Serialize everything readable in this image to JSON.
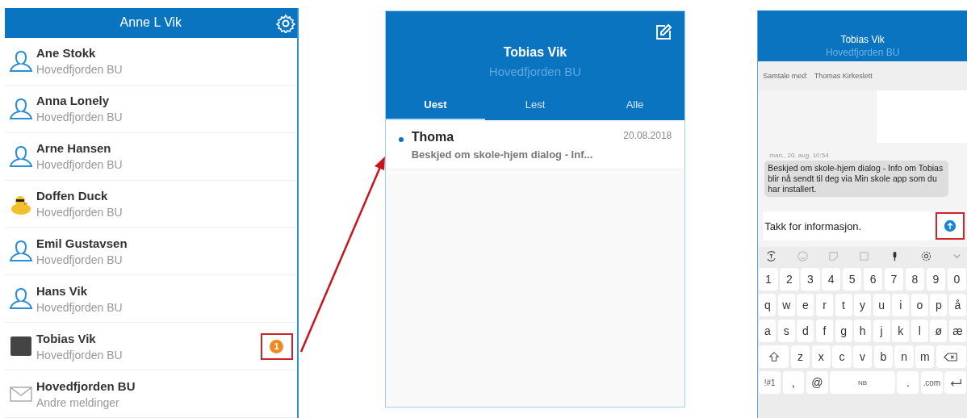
{
  "contacts_panel": {
    "title": "Anne L Vik",
    "contacts": [
      {
        "name": "Ane Stokk",
        "subtitle": "Hovedfjorden BU",
        "kind": "person"
      },
      {
        "name": "Anna Lonely",
        "subtitle": "Hovedfjorden BU",
        "kind": "person"
      },
      {
        "name": "Arne Hansen",
        "subtitle": "Hovedfjorden BU",
        "kind": "person"
      },
      {
        "name": "Doffen Duck",
        "subtitle": "Hovedfjorden BU",
        "kind": "duck"
      },
      {
        "name": "Emil Gustavsen",
        "subtitle": "Hovedfjorden BU",
        "kind": "person"
      },
      {
        "name": "Hans Vik",
        "subtitle": "Hovedfjorden BU",
        "kind": "person"
      },
      {
        "name": "Tobias Vik",
        "subtitle": "Hovedfjorden BU",
        "kind": "photo",
        "badge": "1"
      },
      {
        "name": "Hovedfjorden BU",
        "subtitle": "Andre meldinger",
        "kind": "envelope"
      }
    ]
  },
  "inbox_panel": {
    "title": "Tobias Vik",
    "subtitle": "Hovedfjorden BU",
    "tabs": [
      {
        "label": "Uest",
        "selected": true
      },
      {
        "label": "Lest",
        "selected": false
      },
      {
        "label": "Alle",
        "selected": false
      }
    ],
    "messages": [
      {
        "sender": "Thoma",
        "date": "20.08.2018",
        "preview": "Beskjed om skole-hjem dialog - Inf...",
        "unread": true
      }
    ]
  },
  "chat_panel": {
    "title": "Tobias Vik",
    "subtitle": "Hovedfjorden BU",
    "conversation_label": "Samtale med:",
    "conversation_with": "Thomas Kirkeslett",
    "message": {
      "timestamp": "man., 20. aug. 10:54",
      "text": "Beskjed om skole-hjem dialog - Info om Tobias blir nå sendt til deg via Min skole app som du har installert."
    },
    "input_value": "Takk for informasjon.",
    "keyboard": [
      [
        {
          "kind": "key",
          "label": "1"
        },
        {
          "kind": "key",
          "label": "2"
        },
        {
          "kind": "key",
          "label": "3"
        },
        {
          "kind": "key",
          "label": "4"
        },
        {
          "kind": "key",
          "label": "5"
        },
        {
          "kind": "key",
          "label": "6"
        },
        {
          "kind": "key",
          "label": "7"
        },
        {
          "kind": "key",
          "label": "8"
        },
        {
          "kind": "key",
          "label": "9"
        },
        {
          "kind": "key",
          "label": "0"
        }
      ],
      [
        {
          "kind": "key",
          "label": "q"
        },
        {
          "kind": "key",
          "label": "w"
        },
        {
          "kind": "key",
          "label": "e"
        },
        {
          "kind": "key",
          "label": "r"
        },
        {
          "kind": "key",
          "label": "t"
        },
        {
          "kind": "key",
          "label": "y"
        },
        {
          "kind": "key",
          "label": "u"
        },
        {
          "kind": "key",
          "label": "i"
        },
        {
          "kind": "key",
          "label": "o"
        },
        {
          "kind": "key",
          "label": "p"
        },
        {
          "kind": "key",
          "label": "å"
        }
      ],
      [
        {
          "kind": "key",
          "label": "a"
        },
        {
          "kind": "key",
          "label": "s"
        },
        {
          "kind": "key",
          "label": "d"
        },
        {
          "kind": "key",
          "label": "f"
        },
        {
          "kind": "key",
          "label": "g"
        },
        {
          "kind": "key",
          "label": "h"
        },
        {
          "kind": "key",
          "label": "j"
        },
        {
          "kind": "key",
          "label": "k"
        },
        {
          "kind": "key",
          "label": "l"
        },
        {
          "kind": "key",
          "label": "ø"
        },
        {
          "kind": "key",
          "label": "æ"
        }
      ],
      [
        {
          "kind": "shift"
        },
        {
          "kind": "key",
          "label": "z"
        },
        {
          "kind": "key",
          "label": "x"
        },
        {
          "kind": "key",
          "label": "c"
        },
        {
          "kind": "key",
          "label": "v"
        },
        {
          "kind": "key",
          "label": "b"
        },
        {
          "kind": "key",
          "label": "n"
        },
        {
          "kind": "key",
          "label": "m"
        },
        {
          "kind": "backspace"
        }
      ],
      [
        {
          "kind": "function",
          "label": "!#1"
        },
        {
          "kind": "key",
          "label": ","
        },
        {
          "kind": "key",
          "label": "@"
        },
        {
          "kind": "space",
          "label": "NB"
        },
        {
          "kind": "key",
          "label": "."
        },
        {
          "kind": "function",
          "label": ".com"
        },
        {
          "kind": "enter"
        }
      ]
    ]
  }
}
